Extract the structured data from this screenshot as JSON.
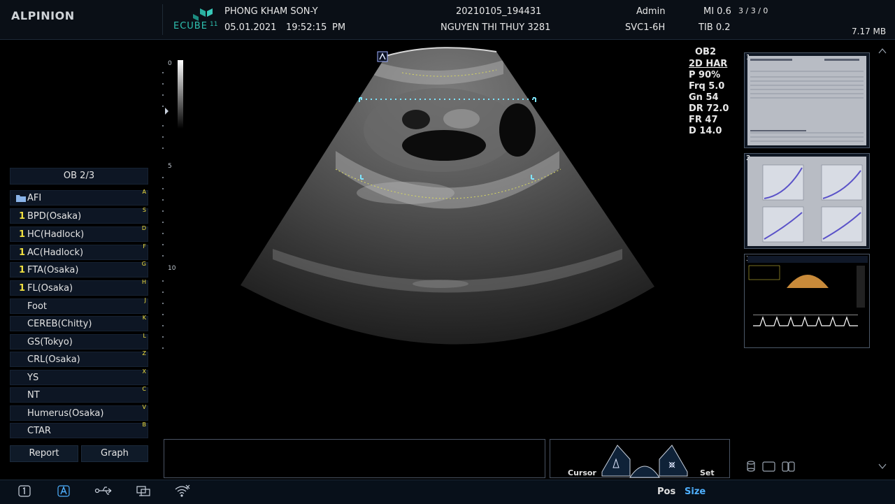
{
  "header": {
    "brand": "ALPINION",
    "logo_text": "ECUBE",
    "logo_sub": "11",
    "hospital": "PHONG KHAM SON-Y",
    "date": "05.01.2021",
    "time": "19:52:15",
    "ampm": "PM",
    "study_id": "20210105_194431",
    "patient": "NGUYEN THI THUY 3281",
    "user": "Admin",
    "probe": "SVC1-6H",
    "mi": "MI 0.6",
    "tib": "TIB 0.2",
    "counts": "3 / 3 / 0",
    "storage": "7.17 MB"
  },
  "depth_scale": {
    "ticks": [
      "0",
      "5",
      "10"
    ]
  },
  "left_panel": {
    "title": "OB 2/3",
    "folder": {
      "label": "AFI",
      "key": "A"
    },
    "items": [
      {
        "num": "1",
        "label": "BPD(Osaka)",
        "key": "S"
      },
      {
        "num": "1",
        "label": "HC(Hadlock)",
        "key": "D"
      },
      {
        "num": "1",
        "label": "AC(Hadlock)",
        "key": "F"
      },
      {
        "num": "1",
        "label": "FTA(Osaka)",
        "key": "G"
      },
      {
        "num": "1",
        "label": "FL(Osaka)",
        "key": "H"
      },
      {
        "num": "",
        "label": "Foot",
        "key": "J"
      },
      {
        "num": "",
        "label": "CEREB(Chitty)",
        "key": "K"
      },
      {
        "num": "",
        "label": "GS(Tokyo)",
        "key": "L"
      },
      {
        "num": "",
        "label": "CRL(Osaka)",
        "key": "Z"
      },
      {
        "num": "",
        "label": "YS",
        "key": "X"
      },
      {
        "num": "",
        "label": "NT",
        "key": "C"
      },
      {
        "num": "",
        "label": "Humerus(Osaka)",
        "key": "V"
      },
      {
        "num": "",
        "label": "CTAR",
        "key": "B"
      }
    ],
    "report_label": "Report",
    "graph_label": "Graph"
  },
  "image_params": {
    "preset": "OB2",
    "mode": "2D HAR",
    "lines": [
      "P 90%",
      "Frq 5.0",
      "Gn 54",
      "DR 72.0",
      "FR 47",
      "D 14.0"
    ]
  },
  "thumbnails": [
    {
      "index": "1"
    },
    {
      "index": "2"
    },
    {
      "index": "3"
    }
  ],
  "trackball": {
    "cursor_label": "Cursor",
    "set_label": "Set"
  },
  "footer": {
    "pos_label": "Pos",
    "size_label": "Size"
  },
  "colors": {
    "accent": "#4fb0ff",
    "key_yellow": "#f0e040",
    "panel": "#0d1624"
  }
}
